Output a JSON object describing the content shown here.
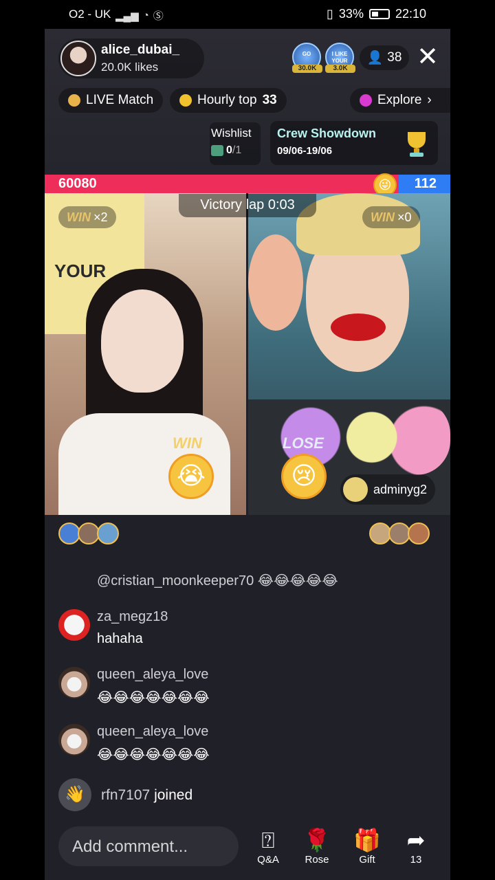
{
  "status_bar": {
    "carrier": "O2 - UK",
    "battery": "33%",
    "time": "22:10"
  },
  "host": {
    "name": "alice_dubai_",
    "likes": "20.0K likes"
  },
  "top_badges": [
    {
      "text": "GO",
      "amount": "30.0K"
    },
    {
      "text": "I LIKE YOUR",
      "amount": "3.0K"
    }
  ],
  "viewers": "38",
  "chips": {
    "live_match": "LIVE Match",
    "hourly_top": "Hourly top",
    "hourly_rank": "33",
    "explore": "Explore"
  },
  "wishlist": {
    "label": "Wishlist",
    "count": "0",
    "total": "/1"
  },
  "crew": {
    "title": "Crew Showdown",
    "dates": "09/06-19/06"
  },
  "score": {
    "left": "60080",
    "right": "112"
  },
  "battle": {
    "victory": "Victory lap 0:03",
    "left": {
      "win_label": "WIN",
      "multiplier": "×2",
      "result": "WIN"
    },
    "right": {
      "win_label": "WIN",
      "multiplier": "×0",
      "result": "LOSE",
      "user": "adminyg2"
    }
  },
  "chat": [
    {
      "user": "",
      "message": "@cristian_moonkeeper70 😂😂😂😂😂"
    },
    {
      "user": "za_megz18",
      "message": "hahaha"
    },
    {
      "user": "queen_aleya_love",
      "message": "😂😂😂😂😂😂😂"
    },
    {
      "user": "queen_aleya_love",
      "message": "😂😂😂😂😂😂😂"
    }
  ],
  "joined": {
    "user": "rfn7107",
    "text": "joined"
  },
  "bottom": {
    "comment_placeholder": "Add comment...",
    "qa": "Q&A",
    "rose": "Rose",
    "gift": "Gift",
    "share": "13"
  },
  "colors": {
    "score_red": "#ee2d5a",
    "score_blue": "#2f7df4",
    "bg": "#1f2028"
  }
}
